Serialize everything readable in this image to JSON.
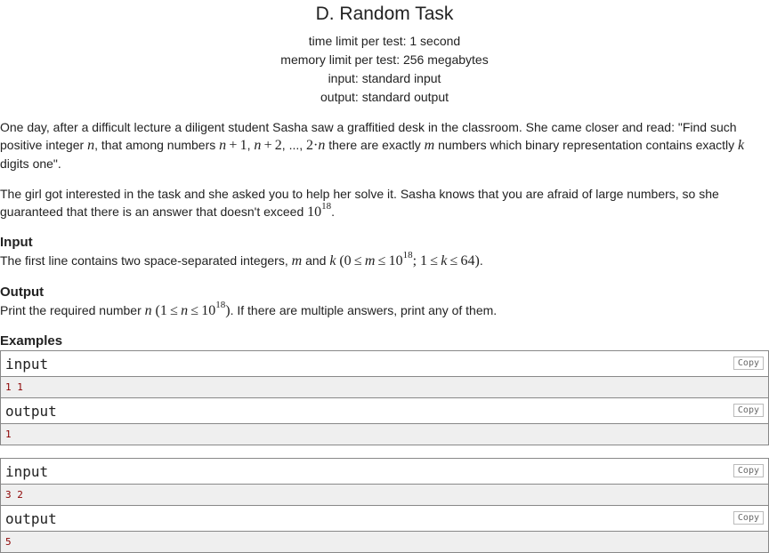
{
  "problem": {
    "title": "D. Random Task",
    "limits": [
      "time limit per test: 1 second",
      "memory limit per test: 256 megabytes",
      "input: standard input",
      "output: standard output"
    ]
  },
  "statement": {
    "p1_a": "One day, after a difficult lecture a diligent student Sasha saw a graffitied desk in the classroom. She came closer and read: \"Find such positive integer",
    "p1_b": ", that among numbers",
    "p1_c": "there are exactly",
    "p1_d": "numbers which binary representation contains exactly",
    "p1_e": "digits one\".",
    "p2": "The girl got interested in the task and she asked you to help her solve it. Sasha knows that you are afraid of large numbers, so she guaranteed that there is an answer that doesn't exceed"
  },
  "input_section": {
    "heading": "Input",
    "text_a": "The first line contains two space-separated integers,",
    "text_b": "and"
  },
  "output_section": {
    "heading": "Output",
    "text_a": "Print the required number",
    "text_b": ". If there are multiple answers, print any of them."
  },
  "examples": {
    "heading": "Examples",
    "copy_label": "Copy",
    "input_label": "input",
    "output_label": "output",
    "tests": [
      {
        "input": "1 1",
        "output": "1"
      },
      {
        "input": "3 2",
        "output": "5"
      }
    ]
  }
}
